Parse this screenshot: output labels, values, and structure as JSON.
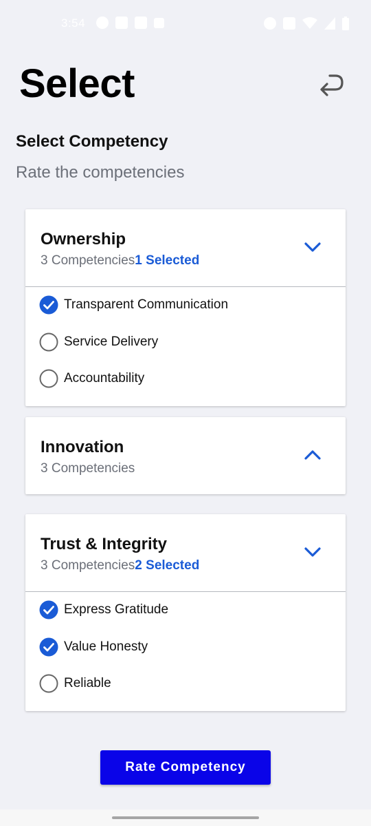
{
  "status_bar": {
    "time": "3:54",
    "left_icons": [
      "app-icon",
      "image-icon",
      "image-icon",
      "image-icon"
    ],
    "right_icons": [
      "alarm-icon",
      "vibrate-icon",
      "wifi-icon",
      "signal-icon",
      "battery-icon"
    ]
  },
  "header": {
    "title": "Select",
    "back_icon": "return-arrow-icon"
  },
  "section": {
    "title": "Select Competency",
    "subtitle": "Rate the competencies"
  },
  "groups": [
    {
      "title": "Ownership",
      "count": "3 Competencies",
      "selected": "1 Selected",
      "expanded": true,
      "options": [
        {
          "label": "Transparent Communication",
          "checked": true
        },
        {
          "label": "Service Delivery",
          "checked": false
        },
        {
          "label": "Accountability",
          "checked": false
        }
      ]
    },
    {
      "title": "Innovation",
      "count": "3 Competencies",
      "selected": "",
      "expanded": false,
      "options": []
    },
    {
      "title": "Trust & Integrity",
      "count": "3 Competencies",
      "selected": "2 Selected",
      "expanded": true,
      "options": [
        {
          "label": "Express Gratitude",
          "checked": true
        },
        {
          "label": "Value Honesty",
          "checked": true
        },
        {
          "label": "Reliable",
          "checked": false
        }
      ]
    }
  ],
  "rate_button": "Rate Competency",
  "colors": {
    "accent": "#1A5BD6",
    "button": "#0A04E8",
    "background": "#F0F1F6"
  }
}
